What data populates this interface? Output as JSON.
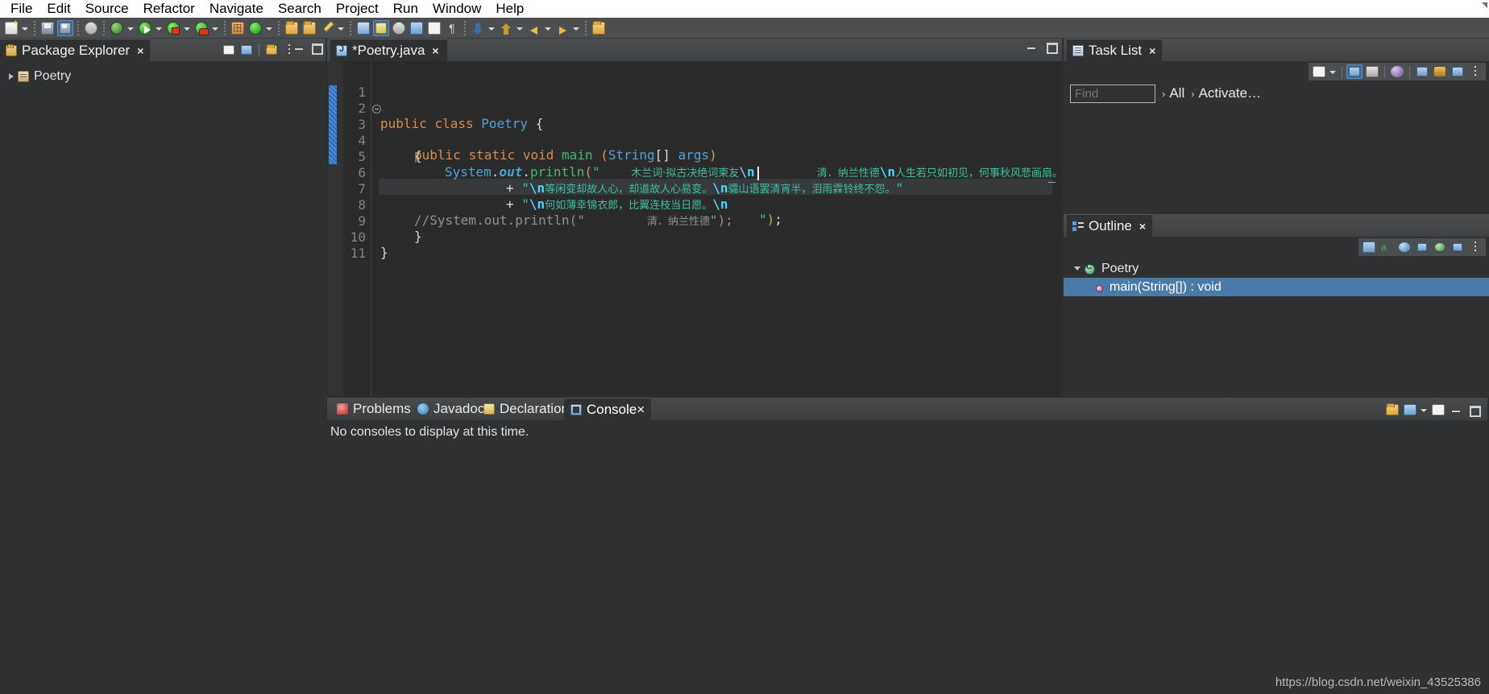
{
  "menu": {
    "items": [
      "File",
      "Edit",
      "Source",
      "Refactor",
      "Navigate",
      "Search",
      "Project",
      "Run",
      "Window",
      "Help"
    ]
  },
  "toolbar": {
    "buttons": [
      {
        "name": "new-wizard",
        "icon": "new-document-icon"
      },
      {
        "name": "new-dropdown",
        "icon": "chevron-down-icon"
      },
      {
        "name": "save",
        "icon": "save-icon"
      },
      {
        "name": "save-all",
        "icon": "save-all-icon"
      },
      {
        "name": "skip-all-breakpoints",
        "icon": "breakpoint-skip-icon"
      },
      {
        "name": "debug",
        "icon": "debug-bug-icon"
      },
      {
        "name": "debug-dropdown",
        "icon": "chevron-down-icon"
      },
      {
        "name": "run",
        "icon": "run-play-icon"
      },
      {
        "name": "run-dropdown",
        "icon": "chevron-down-icon"
      },
      {
        "name": "run-external-tools",
        "icon": "run-server-icon"
      },
      {
        "name": "external-tools-dropdown",
        "icon": "chevron-down-icon"
      },
      {
        "name": "run-coverage",
        "icon": "coverage-icon"
      },
      {
        "name": "coverage-dropdown",
        "icon": "chevron-down-icon"
      },
      {
        "name": "new-java-package",
        "icon": "grid-icon"
      },
      {
        "name": "new-java-class",
        "icon": "new-class-icon"
      },
      {
        "name": "new-class-dropdown",
        "icon": "chevron-down-icon"
      },
      {
        "name": "open-type",
        "icon": "open-folder-icon"
      },
      {
        "name": "open-task",
        "icon": "folder-icon"
      },
      {
        "name": "edit-pencil",
        "icon": "pencil-icon"
      },
      {
        "name": "pencil-dropdown",
        "icon": "chevron-down-icon"
      },
      {
        "name": "toggle-mark-occurrences",
        "icon": "occurrence-icon"
      },
      {
        "name": "toggle-highlight",
        "icon": "highlight-brush-icon"
      },
      {
        "name": "search",
        "icon": "search-icon"
      },
      {
        "name": "next-annotation",
        "icon": "next-annotation-icon"
      },
      {
        "name": "previous-annotation",
        "icon": "previous-annotation-icon"
      },
      {
        "name": "pilcrow",
        "icon": "paragraph-icon"
      },
      {
        "name": "next-edit-location",
        "icon": "down-arrow-icon"
      },
      {
        "name": "next-dropdown",
        "icon": "chevron-down-icon"
      },
      {
        "name": "previous-edit-location",
        "icon": "up-arrow-icon"
      },
      {
        "name": "previous-dropdown",
        "icon": "chevron-down-icon"
      },
      {
        "name": "back",
        "icon": "arrow-left-icon"
      },
      {
        "name": "back-dropdown",
        "icon": "chevron-down-icon"
      },
      {
        "name": "forward",
        "icon": "arrow-right-icon"
      },
      {
        "name": "forward-dropdown",
        "icon": "chevron-down-icon"
      },
      {
        "name": "pin-editor",
        "icon": "pin-icon"
      }
    ]
  },
  "package_explorer": {
    "tab_label": "Package Explorer",
    "tab_close": "×",
    "tree": [
      {
        "label": "Poetry",
        "icon": "project-icon",
        "expandable": true
      }
    ]
  },
  "editor": {
    "tab_label": "*Poetry.java",
    "tab_close": "×",
    "lines": [
      {
        "num": "1",
        "text": ""
      },
      {
        "num": "2",
        "text": "public class Poetry {"
      },
      {
        "num": "3",
        "text": "    public static void main (String[] args)"
      },
      {
        "num": "4",
        "text": "    {"
      },
      {
        "num": "5",
        "text": "        System.out.println(\"    木兰词·拟古决绝词柬友\\n        清．纳兰性德\\n人生若只如初见，何事秋风悲画扇。\""
      },
      {
        "num": "6",
        "text": "                + \"\\n等闲变却故人心，却道故人心易变。\\n骦山语罢清宵半，泪雨霖铃终不怨。\""
      },
      {
        "num": "7",
        "text": "                + \"\\n何如薄幸锦衣郎，比翼连枝当日愿。\\n        \");"
      },
      {
        "num": "8",
        "text": "        //System.out.println(\"        清．纳兰性德\");"
      },
      {
        "num": "9",
        "text": "    }"
      },
      {
        "num": "10",
        "text": "}"
      },
      {
        "num": "11",
        "text": ""
      }
    ],
    "tokens": {
      "kw_public": "public",
      "kw_class": "class",
      "kw_static": "static",
      "kw_void": "void",
      "type_Poetry": "Poetry",
      "type_String": "String",
      "method_main": "main",
      "var_args": "args",
      "sys": "System",
      "out": "out",
      "println": "println",
      "brace_open": "{",
      "brace_close": "}",
      "plus": "+",
      "paren_open": "(",
      "paren_close": ")",
      "bracket": "[]",
      "semicolon": ";",
      "quote": "\"",
      "escape_n": "\\n",
      "title_line": "木兰词·拟古决绝词柬友",
      "author_line": "清．纳兰性德",
      "verse_1": "人生若只如初见，何事秋风悲画扇。",
      "verse_2": "等闲变却故人心，却道故人心易变。",
      "verse_3": "骦山语罢清宵半，泪雨霖铃终不怨。",
      "verse_4": "何如薄幸锦衣郎，比翼连枝当日愿。",
      "comment_prefix": "//System.out.println(\"",
      "comment_suffix": "\");"
    }
  },
  "task_list": {
    "tab_label": "Task List",
    "tab_close": "×",
    "find_placeholder": "Find",
    "filter_all": "All",
    "filter_activate": "Activate…",
    "chevron": "›"
  },
  "outline": {
    "tab_label": "Outline",
    "tab_close": "×",
    "rows": [
      {
        "label": "Poetry",
        "icon": "java-class-icon",
        "selected": false,
        "indent": 0
      },
      {
        "label": "main(String[]) : void",
        "icon": "java-method-icon",
        "selected": true,
        "indent": 1
      }
    ]
  },
  "bottom": {
    "tabs": [
      {
        "label": "Problems",
        "icon": "problems-icon",
        "active": false
      },
      {
        "label": "Javadoc",
        "icon": "javadoc-icon",
        "active": false
      },
      {
        "label": "Declaration",
        "icon": "declaration-icon",
        "active": false
      },
      {
        "label": "Console",
        "icon": "console-icon",
        "active": true,
        "close": "×"
      }
    ],
    "console_message": "No consoles to display at this time."
  },
  "watermark": "https://blog.csdn.net/weixin_43525386",
  "colors": {
    "background": "#2f3133",
    "editor_bg": "#2b2b2b",
    "keyword": "#d58b4a",
    "type": "#4ba3d8",
    "method": "#3fb870",
    "string": "#3fbfa0",
    "escape": "#4fd0ff",
    "comment": "#8a9196",
    "selection": "#4a7ba8",
    "toolbar": "#4b4f52"
  }
}
